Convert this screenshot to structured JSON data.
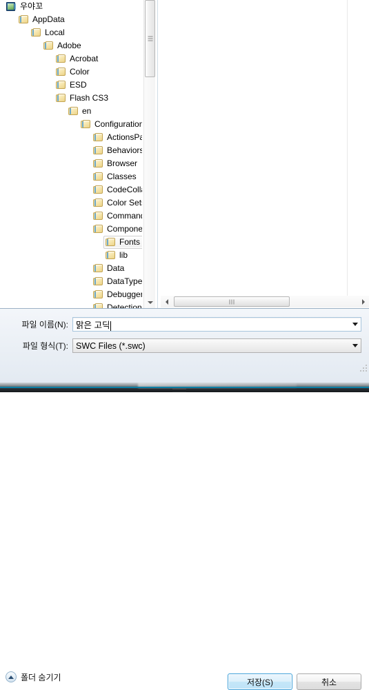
{
  "dialog": {
    "type": "save-file-dialog",
    "accent_color": "#3d9fd8",
    "panel_bg": "#eaeff5"
  },
  "tree": {
    "items": [
      {
        "label": "우야꼬",
        "depth": 0,
        "icon": "user-folder-icon",
        "selected": false
      },
      {
        "label": "AppData",
        "depth": 1,
        "icon": "folder-icon",
        "selected": false
      },
      {
        "label": "Local",
        "depth": 2,
        "icon": "folder-icon",
        "selected": false
      },
      {
        "label": "Adobe",
        "depth": 3,
        "icon": "folder-icon",
        "selected": false
      },
      {
        "label": "Acrobat",
        "depth": 4,
        "icon": "folder-icon",
        "selected": false
      },
      {
        "label": "Color",
        "depth": 4,
        "icon": "folder-icon",
        "selected": false
      },
      {
        "label": "ESD",
        "depth": 4,
        "icon": "folder-icon",
        "selected": false
      },
      {
        "label": "Flash CS3",
        "depth": 4,
        "icon": "folder-icon",
        "selected": false
      },
      {
        "label": "en",
        "depth": 5,
        "icon": "folder-icon",
        "selected": false
      },
      {
        "label": "Configuration",
        "depth": 6,
        "icon": "folder-icon",
        "selected": false
      },
      {
        "label": "ActionsPanel",
        "depth": 7,
        "icon": "folder-icon",
        "selected": false
      },
      {
        "label": "Behaviors",
        "depth": 7,
        "icon": "folder-icon",
        "selected": false
      },
      {
        "label": "Browser",
        "depth": 7,
        "icon": "folder-icon",
        "selected": false
      },
      {
        "label": "Classes",
        "depth": 7,
        "icon": "folder-icon",
        "selected": false
      },
      {
        "label": "CodeCollapse",
        "depth": 7,
        "icon": "folder-icon",
        "selected": false
      },
      {
        "label": "Color Sets",
        "depth": 7,
        "icon": "folder-icon",
        "selected": false
      },
      {
        "label": "Commands",
        "depth": 7,
        "icon": "folder-icon",
        "selected": false
      },
      {
        "label": "Components",
        "depth": 7,
        "icon": "folder-icon",
        "selected": false
      },
      {
        "label": "Fonts",
        "depth": 8,
        "icon": "folder-icon",
        "selected": true
      },
      {
        "label": "lib",
        "depth": 8,
        "icon": "folder-icon",
        "selected": false
      },
      {
        "label": "Data",
        "depth": 7,
        "icon": "folder-icon",
        "selected": false
      },
      {
        "label": "DataTypes",
        "depth": 7,
        "icon": "folder-icon",
        "selected": false
      },
      {
        "label": "Debugger",
        "depth": 7,
        "icon": "folder-icon",
        "selected": false
      },
      {
        "label": "Detection",
        "depth": 7,
        "icon": "folder-icon",
        "selected": false
      }
    ]
  },
  "file_list": {
    "items": []
  },
  "scrollbars": {
    "vertical": {
      "down_arrow_icon": "triangle-down-icon"
    },
    "horizontal": {
      "left_arrow_icon": "triangle-left-icon",
      "right_arrow_icon": "triangle-right-icon"
    }
  },
  "form": {
    "file_name": {
      "label": "파일 이름(N):",
      "value": "맑은 고딕",
      "placeholder": "",
      "dropdown_icon": "chevron-down-icon"
    },
    "file_type": {
      "label": "파일 형식(T):",
      "value": "SWC Files (*.swc)",
      "options": [
        "SWC Files (*.swc)"
      ],
      "dropdown_icon": "chevron-down-icon"
    }
  },
  "footer": {
    "hide_folders": {
      "label": "폴더 숨기기",
      "icon": "chevron-up-circle-icon"
    },
    "save_button": "저장(S)",
    "cancel_button": "취소"
  }
}
